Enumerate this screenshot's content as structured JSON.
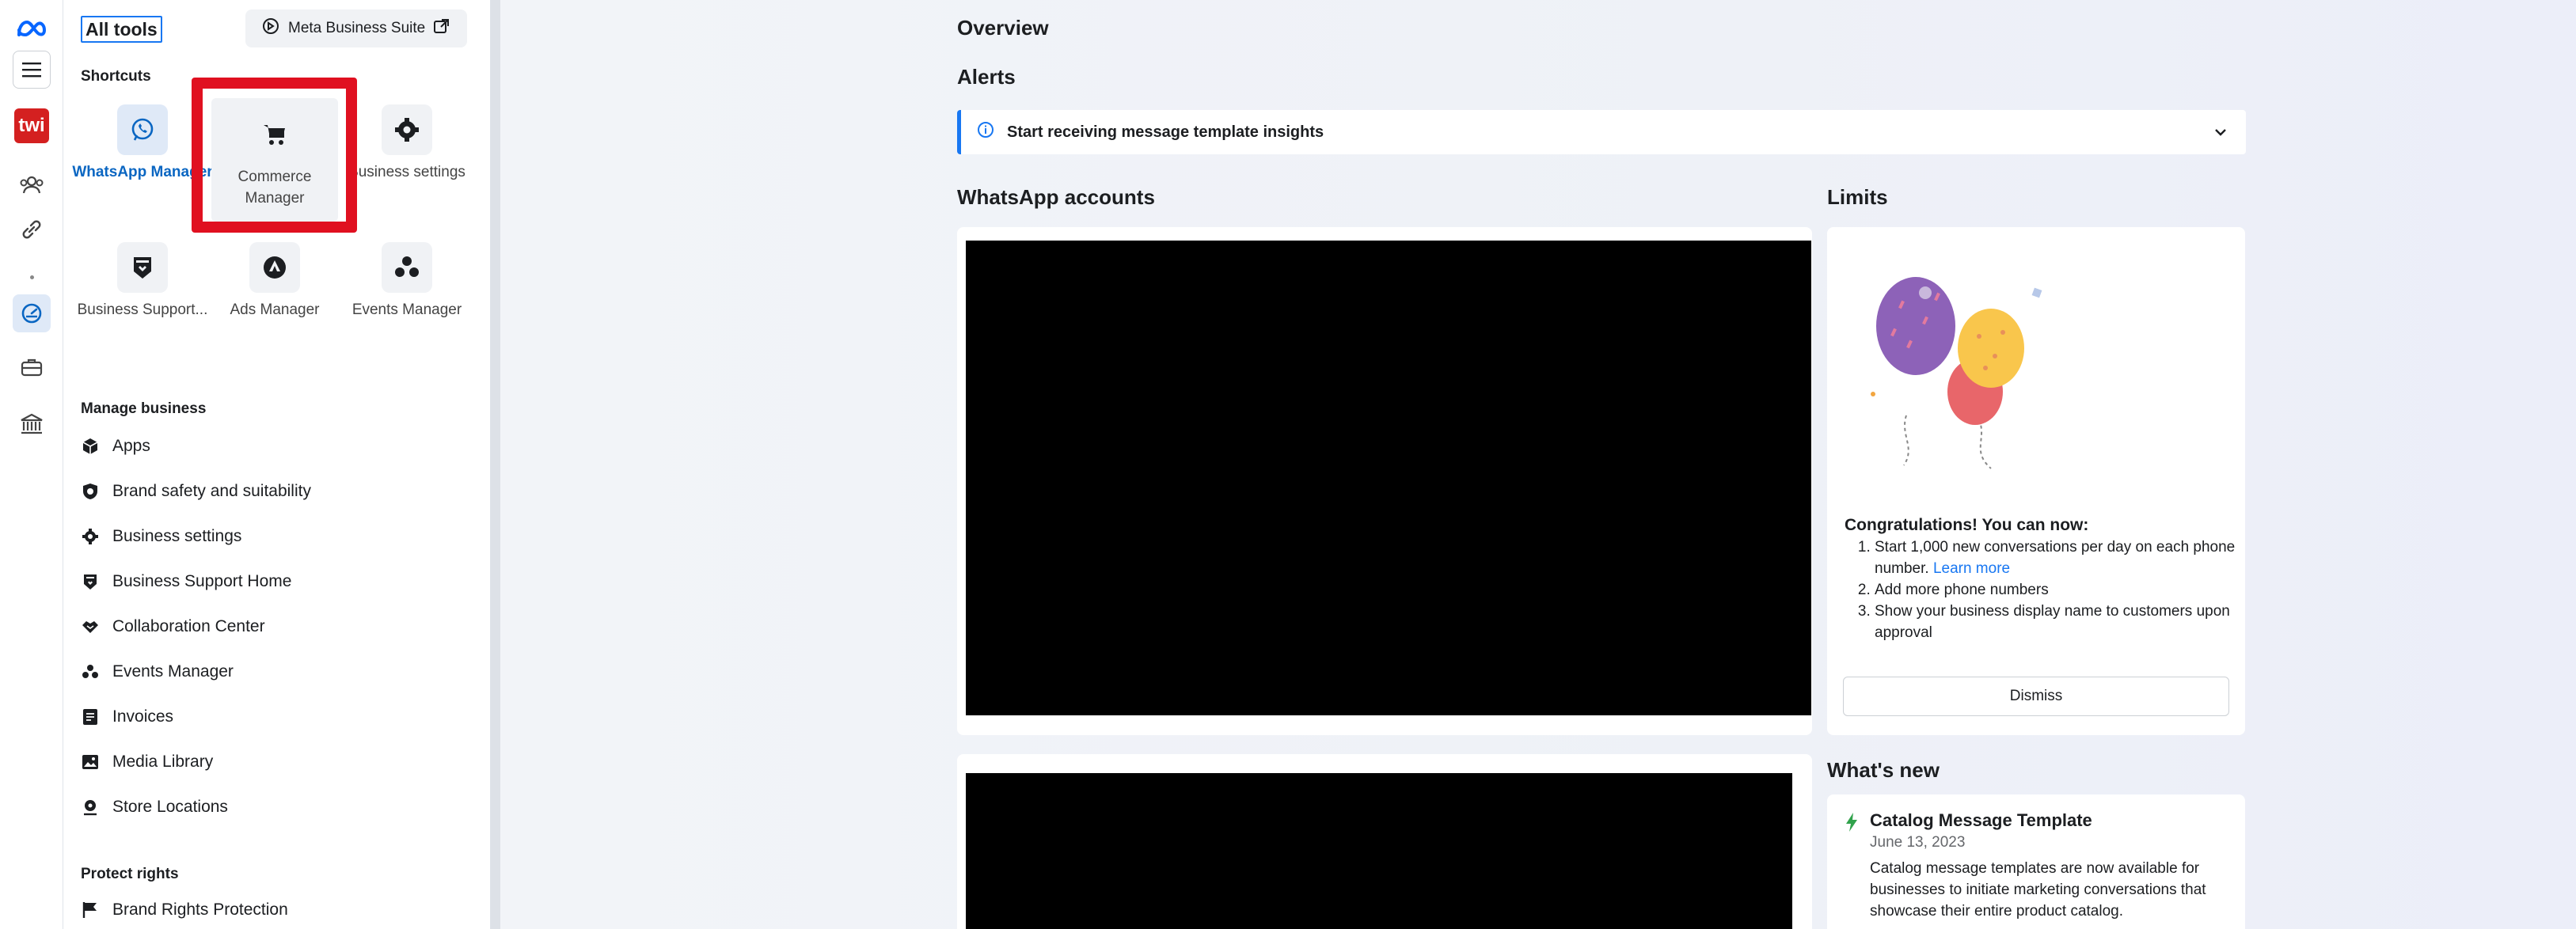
{
  "sidebar": {
    "all_tools": "All tools",
    "meta_business_suite": "Meta Business Suite",
    "shortcuts_label": "Shortcuts",
    "shortcuts": [
      {
        "label": "WhatsApp Manager",
        "icon": "whatsapp-icon",
        "active": true
      },
      {
        "label": "Commerce Manager",
        "icon": "cart-icon",
        "highlighted": true
      },
      {
        "label": "Business settings",
        "icon": "gear-icon"
      },
      {
        "label": "Business Support...",
        "icon": "shield-icon"
      },
      {
        "label": "Ads Manager",
        "icon": "ads-manager-icon"
      },
      {
        "label": "Events Manager",
        "icon": "events-icon"
      }
    ],
    "manage_business_label": "Manage business",
    "manage_business": [
      {
        "label": "Apps",
        "icon": "cube-icon"
      },
      {
        "label": "Brand safety and suitability",
        "icon": "shield-check-icon"
      },
      {
        "label": "Business settings",
        "icon": "gear-icon"
      },
      {
        "label": "Business Support Home",
        "icon": "shield-icon"
      },
      {
        "label": "Collaboration Center",
        "icon": "handshake-icon"
      },
      {
        "label": "Events Manager",
        "icon": "events-icon"
      },
      {
        "label": "Invoices",
        "icon": "invoice-icon"
      },
      {
        "label": "Media Library",
        "icon": "image-icon"
      },
      {
        "label": "Store Locations",
        "icon": "location-icon"
      }
    ],
    "protect_rights_label": "Protect rights",
    "protect_rights": [
      {
        "label": "Brand Rights Protection",
        "icon": "flag-icon"
      }
    ]
  },
  "rail": {
    "brand_badge": "twi"
  },
  "main": {
    "overview": "Overview",
    "alerts": "Alerts",
    "alert_text": "Start receiving message template insights",
    "whatsapp_accounts": "WhatsApp accounts",
    "limits": "Limits",
    "congrats": "Congratulations! You can now:",
    "limit_items": [
      {
        "text": "Start 1,000 new conversations per day on each phone number.",
        "link": "Learn more"
      },
      {
        "text": "Add more phone numbers"
      },
      {
        "text": "Show your business display name to customers upon approval"
      }
    ],
    "dismiss": "Dismiss",
    "whats_new": "What's new",
    "news_title": "Catalog Message Template",
    "news_date": "June 13, 2023",
    "news_body": "Catalog message templates are now available for businesses to initiate marketing conversations that showcase their entire product catalog."
  },
  "colors": {
    "accent": "#1877f2",
    "highlight_box": "#e01020"
  }
}
